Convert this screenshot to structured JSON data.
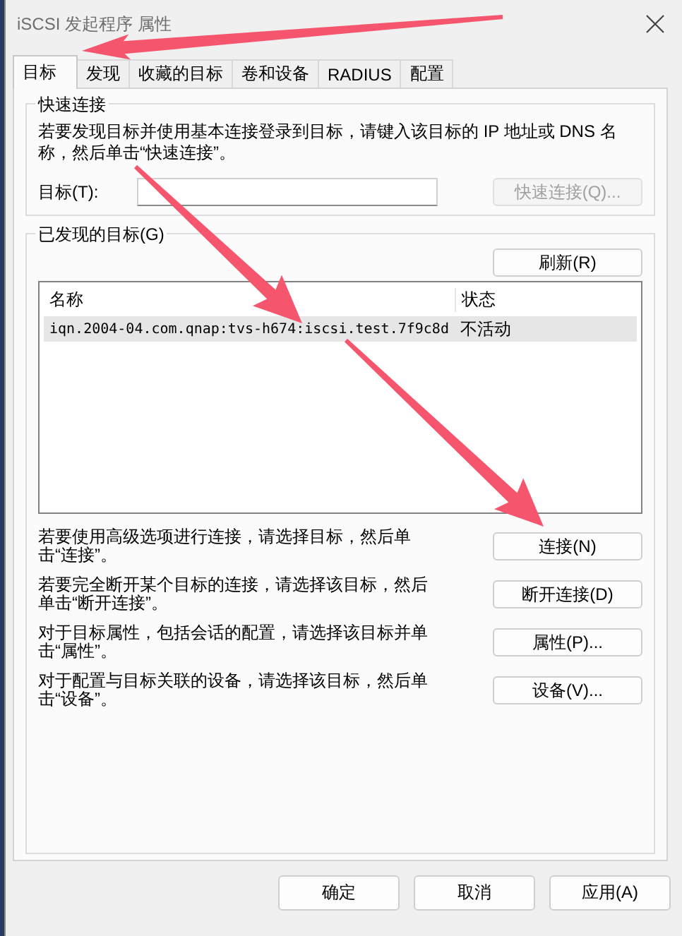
{
  "window": {
    "title": "iSCSI 发起程序 属性"
  },
  "tabs": [
    {
      "label": "目标",
      "selected": true
    },
    {
      "label": "发现",
      "selected": false
    },
    {
      "label": "收藏的目标",
      "selected": false
    },
    {
      "label": "卷和设备",
      "selected": false
    },
    {
      "label": "RADIUS",
      "selected": false
    },
    {
      "label": "配置",
      "selected": false
    }
  ],
  "quick_connect": {
    "title": "快速连接",
    "description": "若要发现目标并使用基本连接登录到目标，请键入该目标的 IP 地址或 DNS 名称，然后单击“快速连接”。",
    "target_label": "目标(T):",
    "button": {
      "label": "快速连接(Q)...",
      "disabled": true
    }
  },
  "discovered": {
    "title": "已发现的目标(G)",
    "refresh_button": "刷新(R)",
    "columns": [
      "名称",
      "状态"
    ],
    "rows": [
      {
        "name": "iqn.2004-04.com.qnap:tvs-h674:iscsi.test.7f9c8d",
        "status": "不活动",
        "selected": true
      }
    ]
  },
  "actions": [
    {
      "description": "若要使用高级选项进行连接，请选择目标，然后单击“连接”。",
      "button": "连接(N)"
    },
    {
      "description": "若要完全断开某个目标的连接，请选择该目标，然后单击“断开连接”。",
      "button": "断开连接(D)"
    },
    {
      "description": "对于目标属性，包括会话的配置，请选择该目标并单击“属性”。",
      "button": "属性(P)..."
    },
    {
      "description": "对于配置与目标关联的设备，请选择该目标，然后单击“设备”。",
      "button": "设备(V)..."
    }
  ],
  "buttons": [
    "确定",
    "取消",
    "应用(A)"
  ],
  "annotations": [
    {
      "kind": "arrow"
    },
    {
      "kind": "arrow"
    },
    {
      "kind": "arrow"
    }
  ]
}
